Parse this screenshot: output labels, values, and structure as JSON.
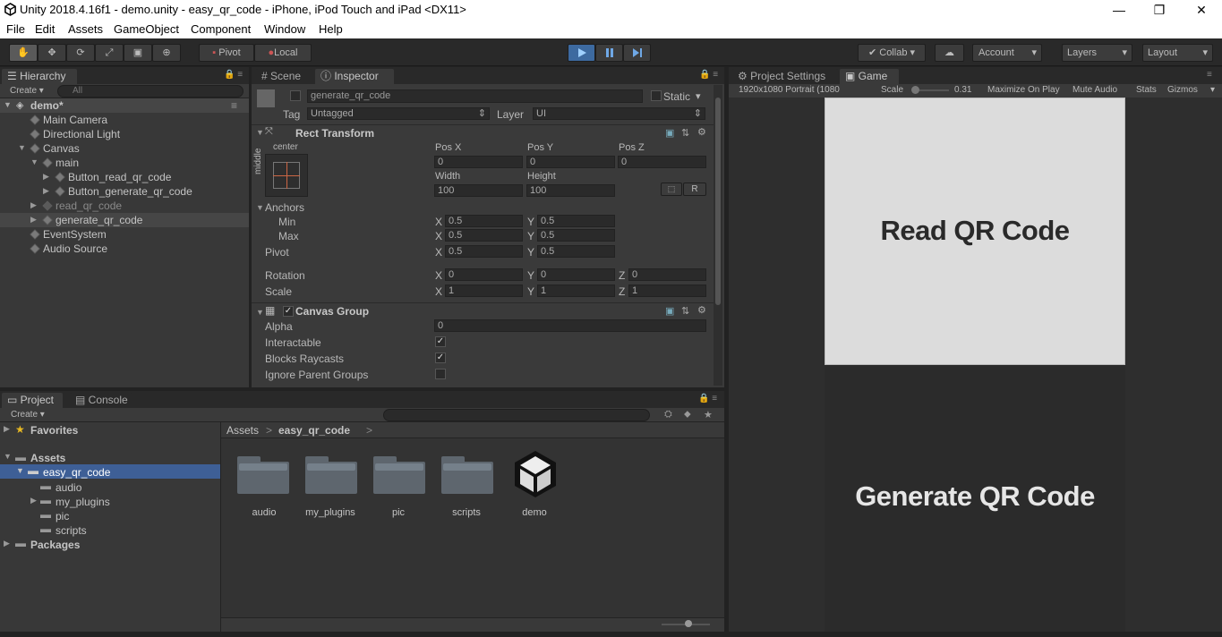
{
  "title_bar": {
    "title": "Unity 2018.4.16f1 - demo.unity - easy_qr_code - iPhone, iPod Touch and iPad <DX11>",
    "minimize": "—",
    "restore": "❐",
    "close": "✕"
  },
  "menu": [
    "File",
    "Edit",
    "Assets",
    "GameObject",
    "Component",
    "Window",
    "Help"
  ],
  "toolbar": {
    "pivot": "Pivot",
    "local": "Local",
    "collab": "Collab",
    "account": "Account",
    "layers": "Layers",
    "layout": "Layout",
    "play_icon": "play-icon",
    "pause_icon": "pause-icon",
    "step_icon": "step-icon"
  },
  "hierarchy": {
    "tab": "Hierarchy",
    "create": "Create",
    "search_placeholder": "All",
    "scene": "demo*",
    "items": [
      {
        "label": "Main Camera",
        "depth": 1
      },
      {
        "label": "Directional Light",
        "depth": 1
      },
      {
        "label": "Canvas",
        "depth": 1
      },
      {
        "label": "main",
        "depth": 2
      },
      {
        "label": "Button_read_qr_code",
        "depth": 3
      },
      {
        "label": "Button_generate_qr_code",
        "depth": 3
      },
      {
        "label": "read_qr_code",
        "depth": 2
      },
      {
        "label": "generate_qr_code",
        "depth": 2
      },
      {
        "label": "EventSystem",
        "depth": 1
      },
      {
        "label": "Audio Source",
        "depth": 1
      }
    ]
  },
  "inspector": {
    "scene_tab": "Scene",
    "tab": "Inspector",
    "object_name": "generate_qr_code",
    "static_label": "Static",
    "tag_label": "Tag",
    "tag_value": "Untagged",
    "layer_label": "Layer",
    "layer_value": "UI",
    "rect_transform": {
      "header": "Rect Transform",
      "anchor_h": "center",
      "anchor_v": "middle",
      "pos_x_label": "Pos X",
      "pos_y_label": "Pos Y",
      "pos_z_label": "Pos Z",
      "pos_x": "0",
      "pos_y": "0",
      "pos_z": "0",
      "width_label": "Width",
      "height_label": "Height",
      "width": "100",
      "height": "100",
      "r_button": "R",
      "anchors_label": "Anchors",
      "min_label": "Min",
      "max_label": "Max",
      "min_x": "0.5",
      "min_y": "0.5",
      "max_x": "0.5",
      "max_y": "0.5",
      "pivot_label": "Pivot",
      "pivot_x": "0.5",
      "pivot_y": "0.5",
      "rotation_label": "Rotation",
      "rot_x": "0",
      "rot_y": "0",
      "rot_z": "0",
      "scale_label": "Scale",
      "scale_x": "1",
      "scale_y": "1",
      "scale_z": "1",
      "x": "X",
      "y": "Y",
      "z": "Z"
    },
    "canvas_group": {
      "header": "Canvas Group",
      "alpha_label": "Alpha",
      "alpha": "0",
      "interactable_label": "Interactable",
      "blocks_raycasts_label": "Blocks Raycasts",
      "ignore_parent_groups_label": "Ignore Parent Groups",
      "check": "✓"
    }
  },
  "game": {
    "project_settings_tab": "Project Settings",
    "tab": "Game",
    "resolution": "1920x1080 Portrait (1080",
    "scale_label": "Scale",
    "scale_value": "0.31",
    "maximize": "Maximize On Play",
    "mute": "Mute Audio",
    "stats": "Stats",
    "gizmos": "Gizmos",
    "read_button": "Read QR Code",
    "generate_button": "Generate QR Code"
  },
  "project": {
    "tab": "Project",
    "console_tab": "Console",
    "create": "Create",
    "favorites": "Favorites",
    "assets": "Assets",
    "tree": [
      "easy_qr_code",
      "audio",
      "my_plugins",
      "pic",
      "scripts"
    ],
    "packages": "Packages",
    "breadcrumb_root": "Assets",
    "breadcrumb_current": "easy_qr_code",
    "breadcrumb_sep": ">",
    "items": [
      "audio",
      "my_plugins",
      "pic",
      "scripts",
      "demo"
    ]
  },
  "colors": {
    "selection": "#3e5f96",
    "game_button_top": "#dcdcdc",
    "game_bg": "#2b2b2b",
    "play_active": "#3d6aa0"
  }
}
